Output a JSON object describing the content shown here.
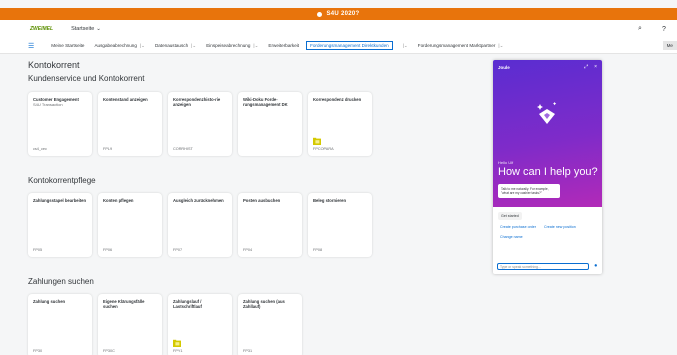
{
  "topbar": {
    "title": "S4U 2020?"
  },
  "shellbar": {
    "logo_text": "ZWEIMEL",
    "home_label": "Startseite"
  },
  "nav": {
    "items": [
      "Meine Startseite",
      "Ausgabeabrechnung",
      "Datenaustausch",
      "Einspeiseabrechnung",
      "Erweiterbarkeit",
      "Forderungsmanagement Direktkunden",
      "Forderungsmanagement Marktpartner"
    ],
    "more_label": "Me"
  },
  "page": {
    "title": "Kontokorrent",
    "sections": [
      {
        "title": "Kundenservice und Kontokorrent",
        "tiles": [
          {
            "title": "Customer Engagement",
            "subtitle": "S4U Transaction",
            "footer": "cs4_cec"
          },
          {
            "title": "Kontenstand anzeigen",
            "subtitle": "",
            "footer": "FPL9"
          },
          {
            "title": "Korrespondenzhisto-rie anzeigen",
            "subtitle": "",
            "footer": "CORRHIST"
          },
          {
            "title": "Wiki-Doku Forde-rungsmanagement DK",
            "subtitle": "",
            "footer": ""
          },
          {
            "title": "Korrespondenz drucken",
            "subtitle": "",
            "footer": "FPCOPARA"
          }
        ]
      },
      {
        "title": "Kontokorrentpflege",
        "tiles": [
          {
            "title": "Zahlungsstapel bearbeiten",
            "subtitle": "",
            "footer": "FP05"
          },
          {
            "title": "Konten pflegen",
            "subtitle": "",
            "footer": "FP06"
          },
          {
            "title": "Ausgleich zurücknehmen",
            "subtitle": "",
            "footer": "FP07"
          },
          {
            "title": "Posten ausbuchen",
            "subtitle": "",
            "footer": "FP04"
          },
          {
            "title": "Beleg stornieren",
            "subtitle": "",
            "footer": "FP08"
          }
        ]
      },
      {
        "title": "Zahlungen suchen",
        "tiles": [
          {
            "title": "Zahlung suchen",
            "subtitle": "",
            "footer": "FP30"
          },
          {
            "title": "Eigene Klärungsfälle suchen",
            "subtitle": "",
            "footer": "FP30C"
          },
          {
            "title": "Zahlungslauf / Lastschriftlauf",
            "subtitle": "",
            "footer": "FPY1"
          },
          {
            "title": "Zahlung suchen (aus Zahllauf)",
            "subtitle": "",
            "footer": "FP31"
          }
        ]
      }
    ]
  },
  "joule": {
    "name": "Joule",
    "hello": "Hello Ulf",
    "help": "How can I help you?",
    "hint": "Talk to me naturally. For example, \"what are my cashier tasks?\"",
    "suggestions": [
      "Get started",
      "Create purchase order",
      "Create new position",
      "Change name"
    ],
    "input_placeholder": "Type or speak something..."
  },
  "colors": {
    "brand": "#e8740c",
    "accent": "#0a6ed1",
    "joule_start": "#5a2dd1",
    "joule_end": "#b22ab8"
  }
}
